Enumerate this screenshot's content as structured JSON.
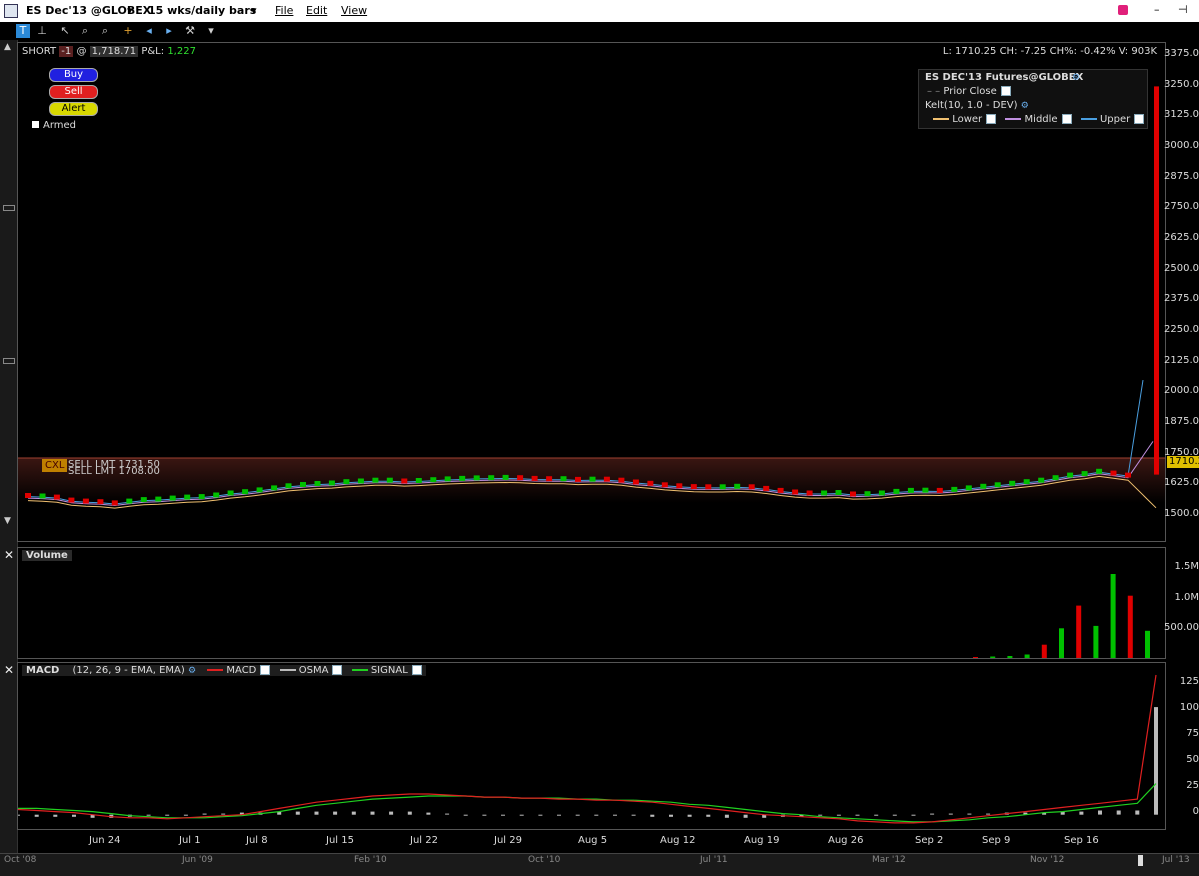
{
  "window": {
    "symbol": "ES Dec'13 @GLOBEX",
    "period": "15 wks/daily bars",
    "menus": [
      "File",
      "Edit",
      "View"
    ]
  },
  "position_line": {
    "side": "SHORT",
    "qty": "-1",
    "at": "@",
    "price": "1,718.71",
    "pnl_label": "P&L:",
    "pnl_value": "1,227"
  },
  "quote_line": "L: 1710.25 CH: -7.25 CH%: -0.42% V: 903K",
  "order_buttons": {
    "buy": "Buy",
    "sell": "Sell",
    "alert": "Alert",
    "armed": "Armed"
  },
  "price_legend": {
    "title": "ES DEC'13 Futures@GLOBEX",
    "prior_close": "Prior Close",
    "kelt": "Kelt(10, 1.0 - DEV)",
    "lower": "Lower",
    "middle": "Middle",
    "upper": "Upper"
  },
  "orders": {
    "cxl": "CXL",
    "line1": "SELL LMT 1731.50",
    "line2": "SELL LMT 1708.00"
  },
  "current_price_tag": "1710.2",
  "volume_panel": {
    "title": "Volume"
  },
  "macd_panel": {
    "title": "MACD",
    "params": "(12, 26, 9 - EMA, EMA)",
    "macd": "MACD",
    "osma": "OSMA",
    "signal": "SIGNAL"
  },
  "price_axis": [
    "3375.0",
    "3250.0",
    "3125.0",
    "3000.0",
    "2875.0",
    "2750.0",
    "2625.0",
    "2500.0",
    "2375.0",
    "2250.0",
    "2125.0",
    "2000.0",
    "1875.0",
    "1750.0",
    "1625.0",
    "1500.0"
  ],
  "volume_axis": [
    "1.5M",
    "1.0M",
    "500.00"
  ],
  "macd_axis": [
    "125",
    "100",
    "75",
    "50",
    "25",
    "0"
  ],
  "x_axis": [
    "Jun 24",
    "Jul 1",
    "Jul 8",
    "Jul 15",
    "Jul 22",
    "Jul 29",
    "Aug 5",
    "Aug 12",
    "Aug 19",
    "Aug 26",
    "Sep 2",
    "Sep 9",
    "Sep 16"
  ],
  "overview_axis": [
    "Oct '08",
    "Jun '09",
    "Feb '10",
    "Oct '10",
    "Jul '11",
    "Mar '12",
    "Nov '12",
    "Jul '13"
  ],
  "colors": {
    "up": "#00c000",
    "down": "#e00000",
    "macd": "#e02020",
    "signal": "#20d020",
    "osma": "#bbbbbb",
    "upper": "#4a9fe0",
    "middle": "#c090e0",
    "lower": "#f0c070"
  },
  "chart_data": {
    "type": "bar",
    "candles_close": [
      1630,
      1628,
      1624,
      1612,
      1608,
      1606,
      1601,
      1608,
      1614,
      1616,
      1620,
      1624,
      1626,
      1632,
      1640,
      1645,
      1652,
      1660,
      1668,
      1673,
      1677,
      1679,
      1684,
      1687,
      1690,
      1690,
      1687,
      1689,
      1692,
      1695,
      1697,
      1699,
      1700,
      1701,
      1700,
      1697,
      1696,
      1696,
      1693,
      1694,
      1694,
      1690,
      1683,
      1678,
      1672,
      1668,
      1665,
      1664,
      1664,
      1666,
      1664,
      1658,
      1650,
      1644,
      1640,
      1640,
      1642,
      1636,
      1637,
      1640,
      1646,
      1650,
      1651,
      1650,
      1654,
      1660,
      1666,
      1672,
      1678,
      1684,
      1690,
      1700,
      1710,
      1716,
      1725,
      1718,
      1710
    ],
    "candles_up": [
      false,
      true,
      false,
      false,
      false,
      false,
      false,
      true,
      true,
      true,
      true,
      true,
      true,
      true,
      true,
      true,
      true,
      true,
      true,
      true,
      true,
      true,
      true,
      true,
      true,
      true,
      false,
      true,
      true,
      true,
      true,
      true,
      true,
      true,
      false,
      false,
      false,
      true,
      false,
      true,
      false,
      false,
      false,
      false,
      false,
      false,
      false,
      false,
      true,
      true,
      false,
      false,
      false,
      false,
      false,
      true,
      true,
      false,
      true,
      true,
      true,
      true,
      true,
      false,
      true,
      true,
      true,
      true,
      true,
      true,
      true,
      true,
      true,
      true,
      true,
      false,
      false
    ],
    "spike_high": 3230,
    "volume_bars": [
      {
        "v": 20,
        "up": false
      },
      {
        "v": 30,
        "up": true
      },
      {
        "v": 40,
        "up": true
      },
      {
        "v": 70,
        "up": true
      },
      {
        "v": 270,
        "up": false
      },
      {
        "v": 600,
        "up": true
      },
      {
        "v": 1060,
        "up": false
      },
      {
        "v": 650,
        "up": true
      },
      {
        "v": 1700,
        "up": true
      },
      {
        "v": 1260,
        "up": false
      },
      {
        "v": 550,
        "up": true
      }
    ],
    "macd_line": [
      5,
      4,
      3,
      2,
      0,
      -2,
      -3,
      -3,
      -4,
      -3,
      -2,
      -1,
      0,
      3,
      6,
      9,
      12,
      14,
      16,
      18,
      19,
      20,
      20,
      19,
      18,
      17,
      17,
      16,
      16,
      15,
      15,
      14,
      14,
      13,
      12,
      10,
      8,
      6,
      4,
      2,
      0,
      -1,
      -2,
      -3,
      -4,
      -6,
      -7,
      -8,
      -8,
      -7,
      -5,
      -3,
      -1,
      1,
      3,
      5,
      7,
      9,
      11,
      13,
      15,
      135
    ],
    "signal_line": [
      6,
      6,
      5,
      4,
      3,
      1,
      -1,
      -2,
      -3,
      -3,
      -3,
      -2,
      -1,
      1,
      3,
      6,
      9,
      11,
      13,
      15,
      16,
      17,
      18,
      18,
      18,
      17,
      17,
      16,
      16,
      16,
      15,
      15,
      14,
      14,
      13,
      12,
      10,
      9,
      7,
      5,
      3,
      1,
      0,
      -2,
      -3,
      -4,
      -5,
      -6,
      -7,
      -7,
      -6,
      -5,
      -3,
      -2,
      0,
      2,
      3,
      5,
      7,
      9,
      11,
      30
    ],
    "osma_bars": [
      -1,
      -2,
      -2,
      -2,
      -3,
      -3,
      -2,
      -1,
      -1,
      0,
      1,
      1,
      2,
      2,
      3,
      3,
      3,
      3,
      3,
      3,
      3,
      3,
      2,
      1,
      0,
      0,
      0,
      0,
      0,
      0,
      0,
      -1,
      -1,
      -1,
      -2,
      -2,
      -2,
      -2,
      -3,
      -3,
      -3,
      -2,
      -2,
      -1,
      -1,
      -1,
      -1,
      0,
      0,
      1,
      1,
      1,
      1,
      2,
      2,
      2,
      3,
      3,
      4,
      4,
      4,
      104
    ],
    "price_ylim": [
      1450,
      3400
    ],
    "macd_ylim": [
      -10,
      135
    ]
  }
}
